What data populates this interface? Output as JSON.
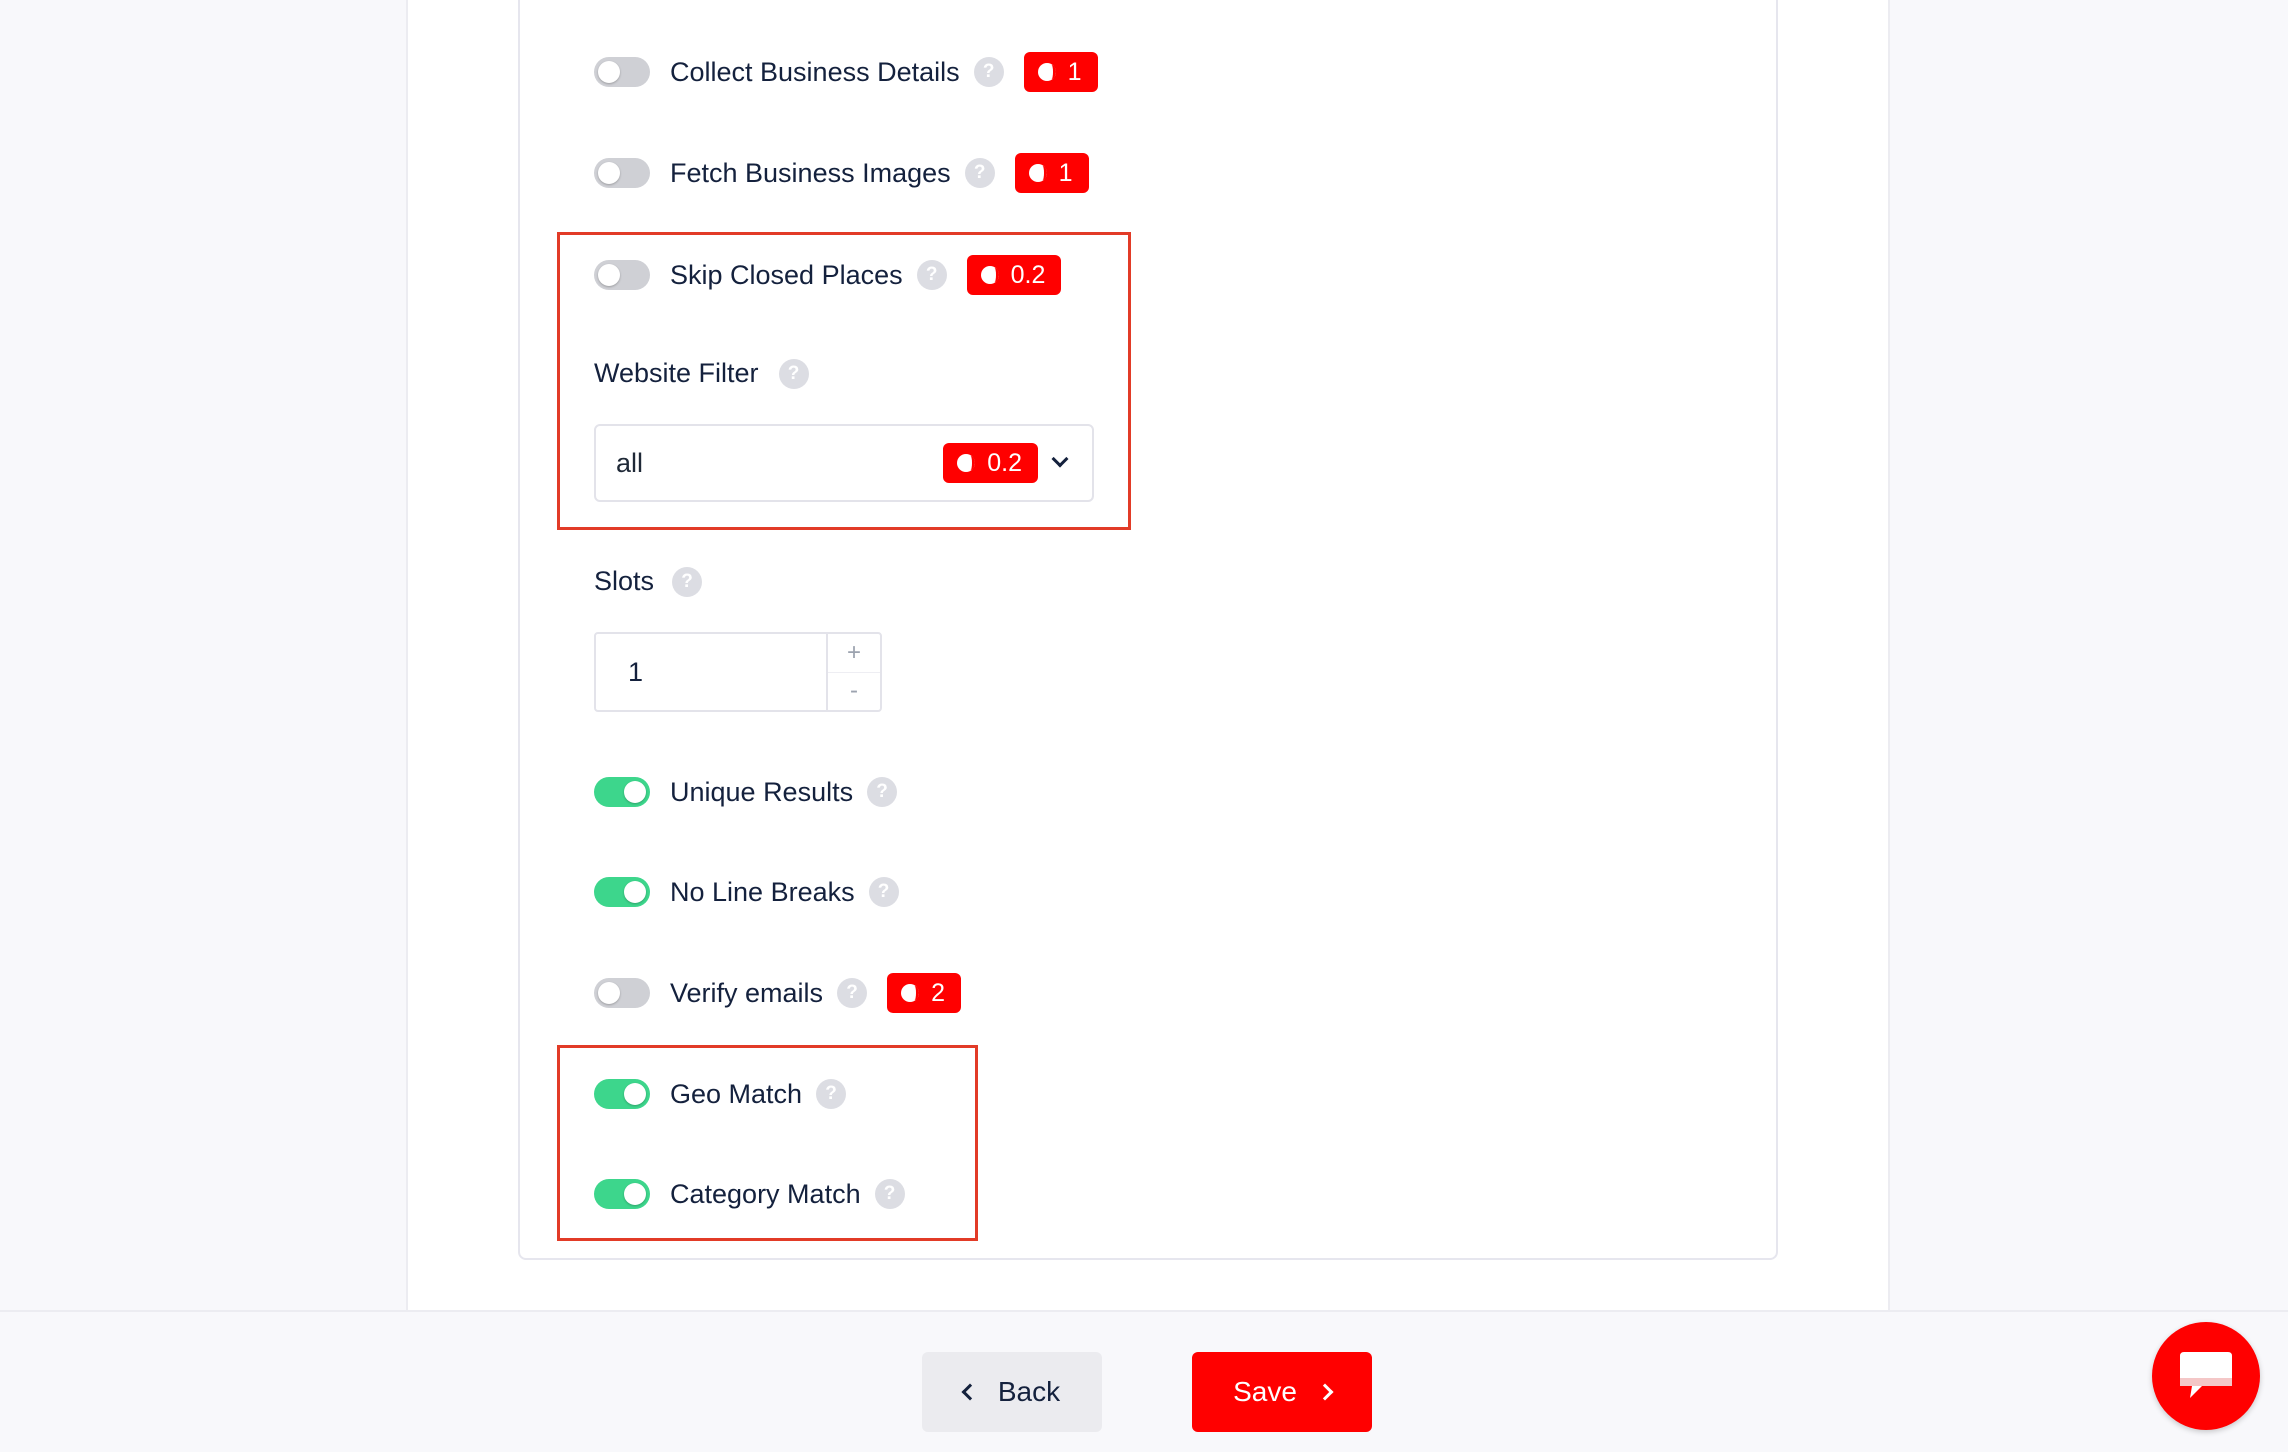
{
  "options": {
    "collect_business_details": {
      "label": "Collect Business Details",
      "enabled": false,
      "credits": "1"
    },
    "fetch_business_images": {
      "label": "Fetch Business Images",
      "enabled": false,
      "credits": "1"
    },
    "skip_closed_places": {
      "label": "Skip Closed Places",
      "enabled": false,
      "credits": "0.2"
    },
    "unique_results": {
      "label": "Unique Results",
      "enabled": true
    },
    "no_line_breaks": {
      "label": "No Line Breaks",
      "enabled": true
    },
    "verify_emails": {
      "label": "Verify emails",
      "enabled": false,
      "credits": "2"
    },
    "geo_match": {
      "label": "Geo Match",
      "enabled": true
    },
    "category_match": {
      "label": "Category Match",
      "enabled": true
    }
  },
  "website_filter": {
    "label": "Website Filter",
    "value": "all",
    "credits": "0.2"
  },
  "slots": {
    "label": "Slots",
    "value": "1",
    "increment": "+",
    "decrement": "-"
  },
  "help_glyph": "?",
  "footer": {
    "back_label": "Back",
    "save_label": "Save"
  },
  "colors": {
    "accent": "#ff0000",
    "toggle_on": "#3dd68c",
    "toggle_off": "#cfd0d5",
    "highlight": "#e23b27"
  },
  "icons": {
    "credits": "coin-icon",
    "help": "help-icon",
    "chat": "chat-icon"
  }
}
